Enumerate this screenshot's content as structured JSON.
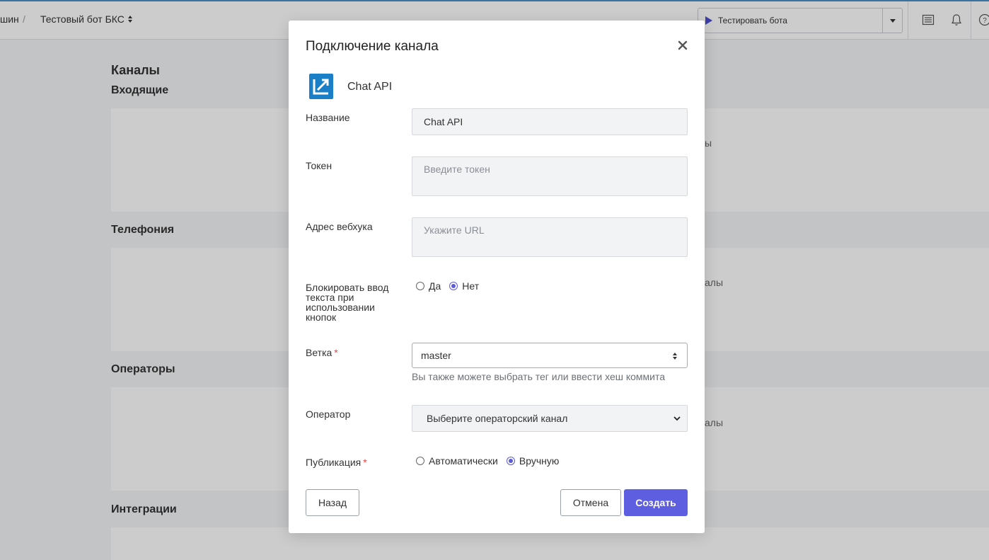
{
  "topbar": {
    "crumb_prev": "шин",
    "crumb_sep": "/",
    "bot_name": "Тестовый бот БКС",
    "test_button": "Тестировать бота"
  },
  "page": {
    "title": "Каналы",
    "sections": [
      {
        "title": "Входящие",
        "hint": "ы"
      },
      {
        "title": "Телефония",
        "hint": "алы"
      },
      {
        "title": "Операторы",
        "hint": "алы"
      },
      {
        "title": "Интеграции",
        "hint": ""
      }
    ]
  },
  "modal": {
    "title": "Подключение канала",
    "channel_name": "Chat API",
    "fields": {
      "name": {
        "label": "Название",
        "value": "Chat API"
      },
      "token": {
        "label": "Токен",
        "placeholder": "Введите токен"
      },
      "webhook": {
        "label": "Адрес вебхука",
        "placeholder": "Укажите URL"
      },
      "block_input": {
        "label": "Блокировать ввод текста при использовании кнопок",
        "option_yes": "Да",
        "option_no": "Нет",
        "selected": "Нет"
      },
      "branch": {
        "label": "Ветка",
        "required_mark": "*",
        "value": "master",
        "help": "Вы также можете выбрать тег или ввести хеш коммита"
      },
      "operator": {
        "label": "Оператор",
        "value": "Выберите операторский канал"
      },
      "publication": {
        "label": "Публикация",
        "required_mark": "*",
        "option_auto": "Автоматически",
        "option_manual": "Вручную",
        "selected": "Вручную"
      }
    },
    "buttons": {
      "back": "Назад",
      "cancel": "Отмена",
      "create": "Создать"
    }
  },
  "colors": {
    "accent": "#5e5ee0",
    "radio_checked": "#5b5bd6",
    "required": "#e54747",
    "logo_blue": "#1b7fc7"
  }
}
